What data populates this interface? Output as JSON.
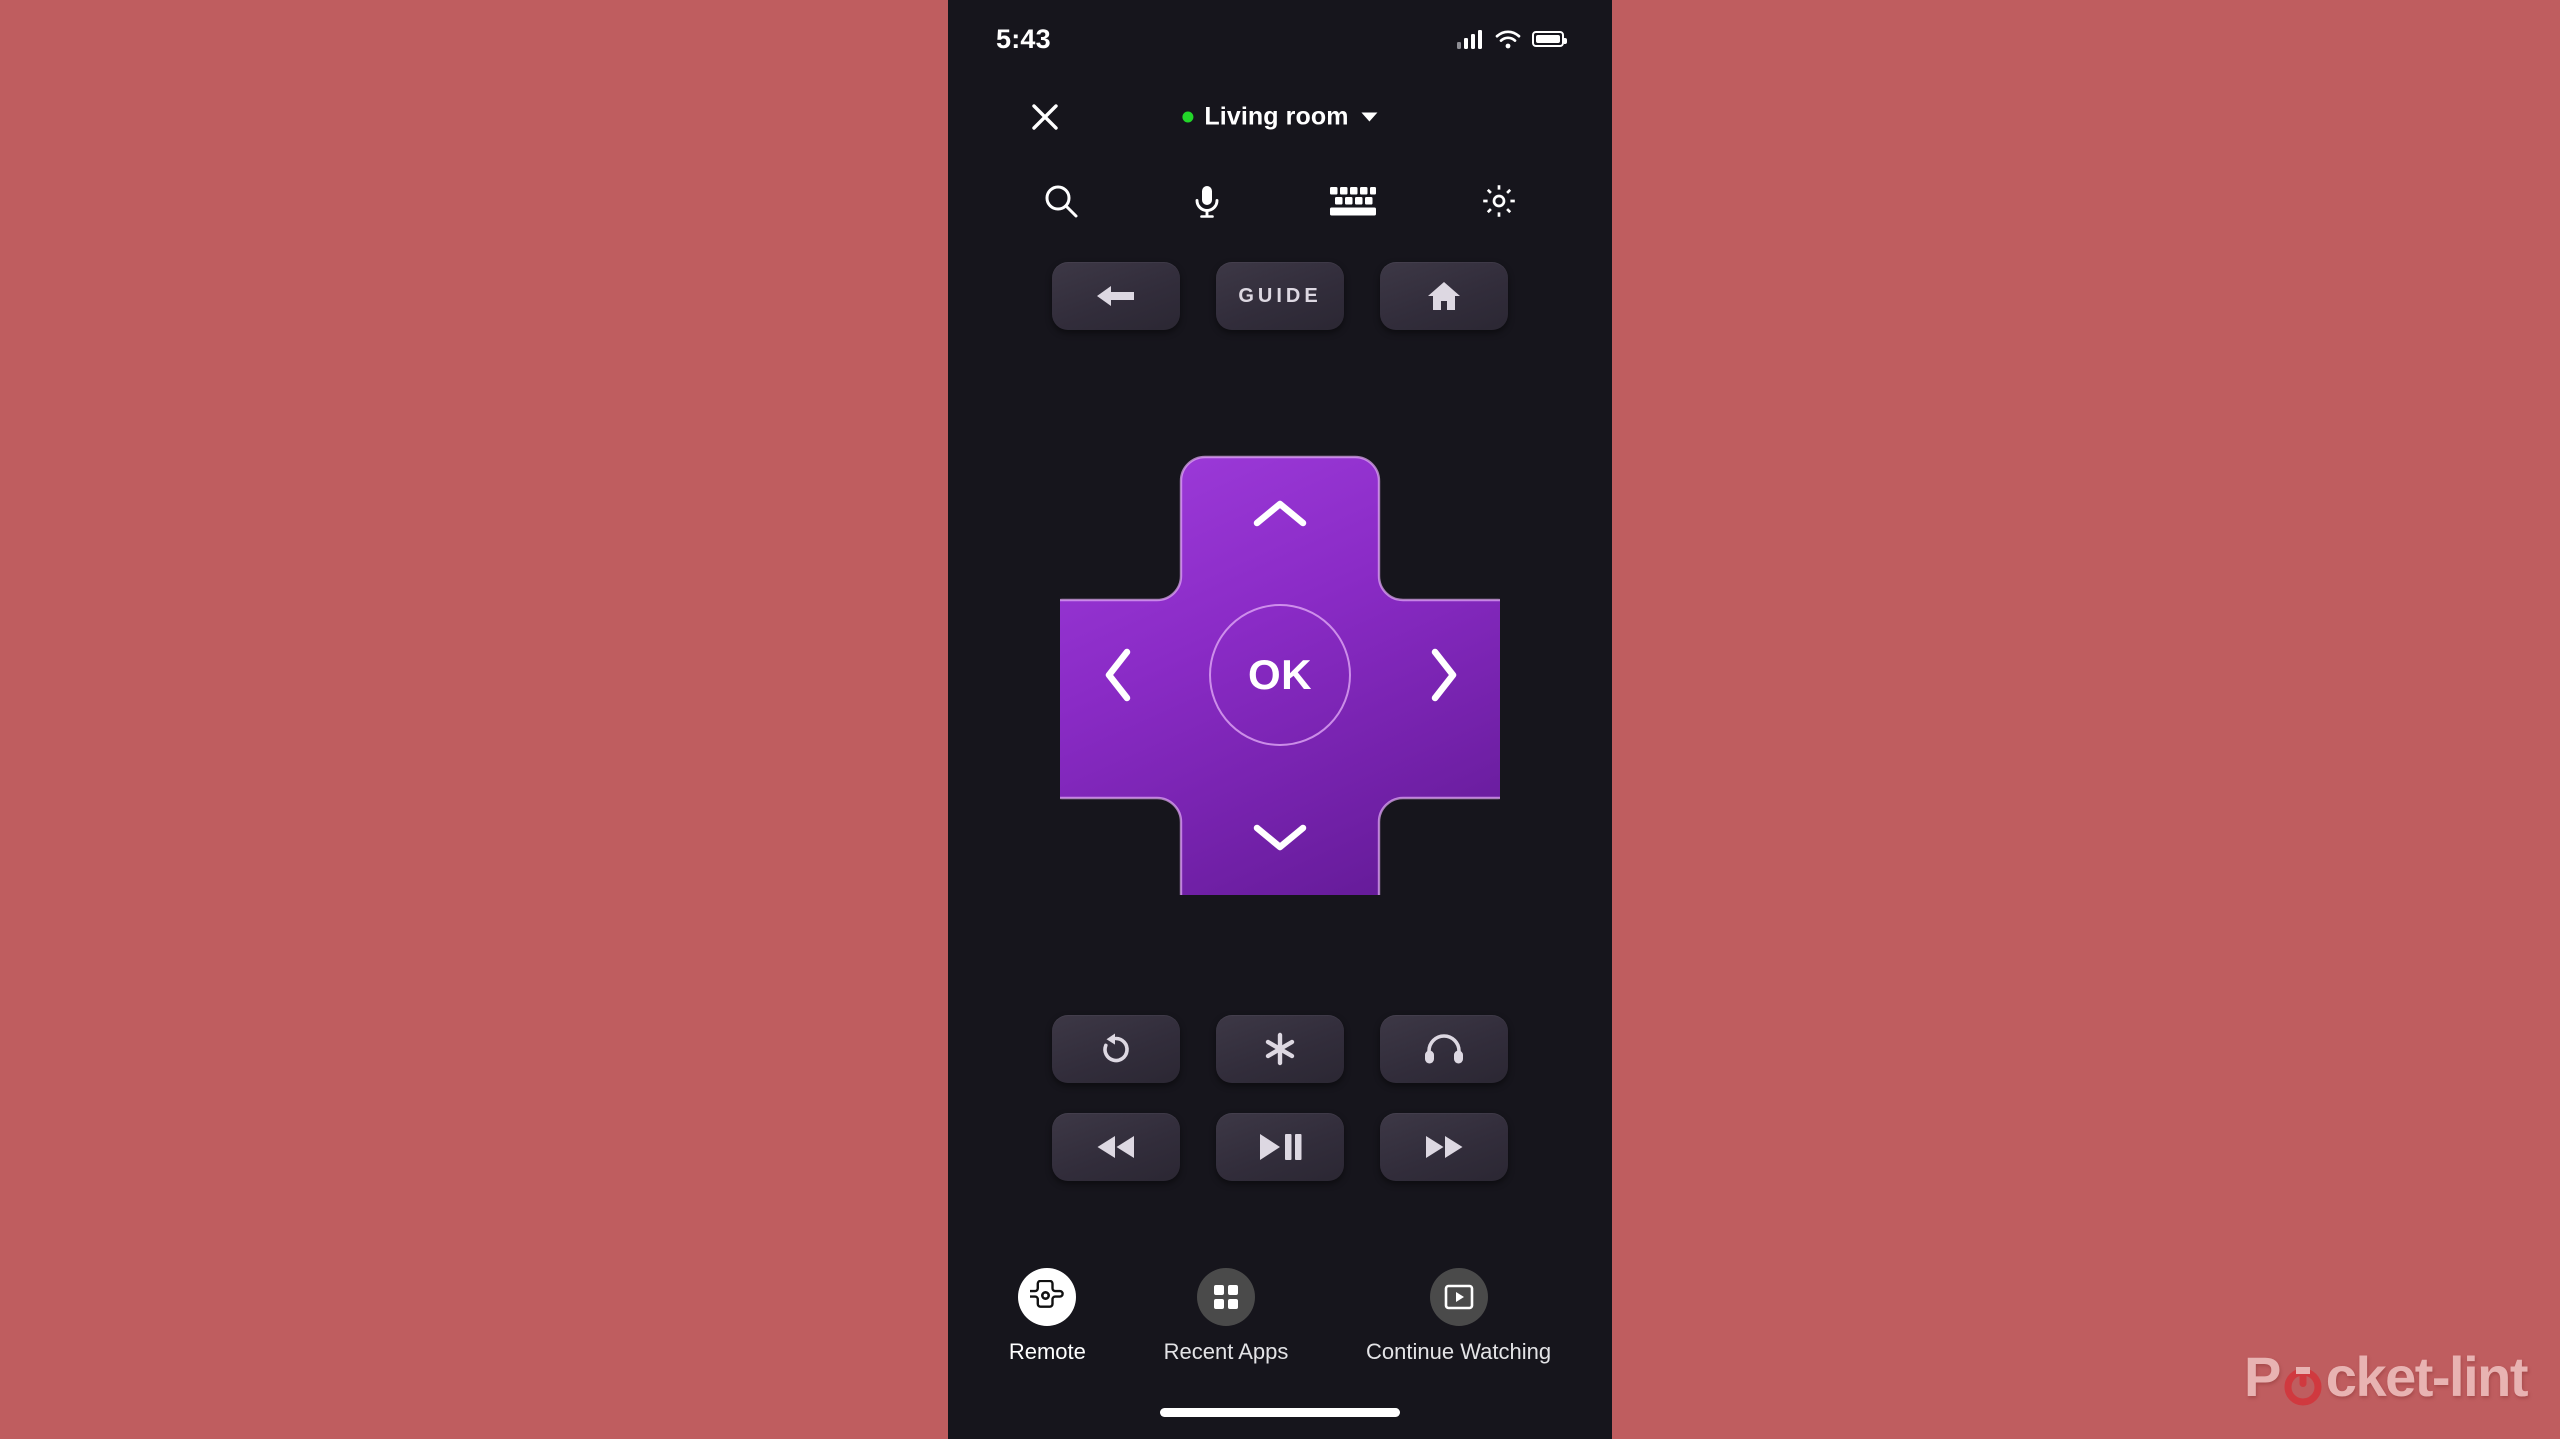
{
  "page": {
    "background_color": "#bf5d5f",
    "screen_background": "#16151c"
  },
  "status_bar": {
    "time": "5:43",
    "icons": [
      "cellular-signal-icon",
      "wifi-icon",
      "battery-icon"
    ]
  },
  "header": {
    "close_label": "close-icon",
    "device_status_color": "#22d629",
    "device_name": "Living room",
    "dropdown_caret": "chevron-down-icon"
  },
  "quick_actions": [
    {
      "name": "search",
      "icon": "search-icon"
    },
    {
      "name": "voice",
      "icon": "microphone-icon"
    },
    {
      "name": "keyboard",
      "icon": "keyboard-icon"
    },
    {
      "name": "settings",
      "icon": "gear-icon"
    }
  ],
  "nav_buttons": [
    {
      "name": "back",
      "icon": "arrow-left-icon",
      "label": ""
    },
    {
      "name": "guide",
      "icon": "",
      "label": "GUIDE"
    },
    {
      "name": "home",
      "icon": "home-icon",
      "label": ""
    }
  ],
  "dpad": {
    "up_label": "chevron-up-icon",
    "down_label": "chevron-down-icon",
    "left_label": "chevron-left-icon",
    "right_label": "chevron-right-icon",
    "ok_label": "OK",
    "color_light": "#9b35d4",
    "color_dark": "#6a1e9e",
    "border_color": "#e2aaf6"
  },
  "media_buttons": [
    {
      "name": "replay",
      "icon": "replay-icon"
    },
    {
      "name": "options",
      "icon": "asterisk-icon"
    },
    {
      "name": "headphones",
      "icon": "headphones-icon"
    },
    {
      "name": "rewind",
      "icon": "rewind-icon"
    },
    {
      "name": "play-pause",
      "icon": "play-pause-icon"
    },
    {
      "name": "fast-forward",
      "icon": "fast-forward-icon"
    }
  ],
  "bottom_nav": [
    {
      "label": "Remote",
      "icon": "dpad-icon",
      "active": true
    },
    {
      "label": "Recent Apps",
      "icon": "grid-apps-icon",
      "active": false
    },
    {
      "label": "Continue Watching",
      "icon": "play-frame-icon",
      "active": false
    }
  ],
  "watermark": {
    "text_before": "P",
    "text_after": "cket-lint",
    "power_icon": "power-icon",
    "accent_color": "#d0393f"
  }
}
